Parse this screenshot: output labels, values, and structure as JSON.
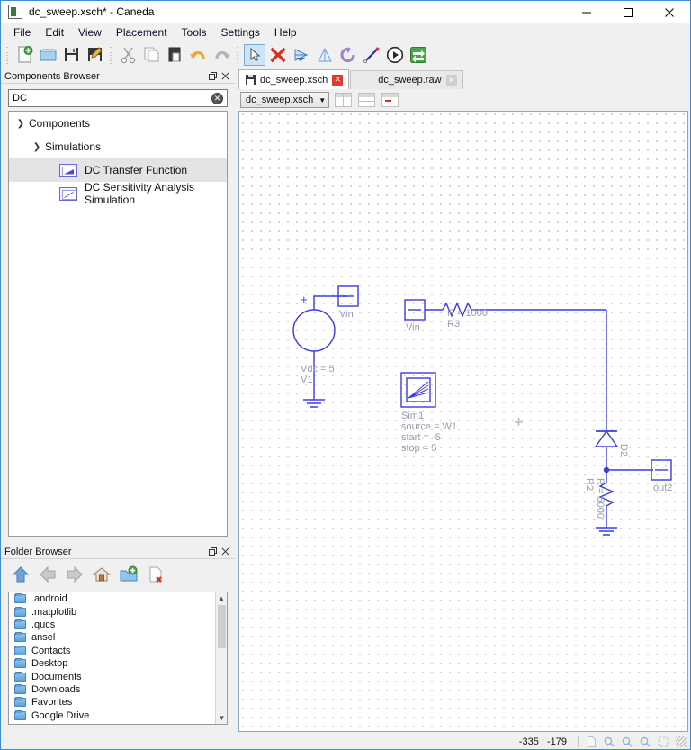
{
  "window": {
    "title": "dc_sweep.xsch* - Caneda",
    "app_icon": "schematic-icon",
    "minimize": "minimize-icon",
    "maximize": "maximize-icon",
    "close": "close-icon"
  },
  "menubar": {
    "items": [
      {
        "label": "File"
      },
      {
        "label": "Edit"
      },
      {
        "label": "View"
      },
      {
        "label": "Placement"
      },
      {
        "label": "Tools"
      },
      {
        "label": "Settings"
      },
      {
        "label": "Help"
      }
    ]
  },
  "toolbar": {
    "groups": [
      {
        "buttons": [
          {
            "name": "new-document-button",
            "icon": "new-document-icon"
          },
          {
            "name": "open-document-button",
            "icon": "open-folder-icon"
          },
          {
            "name": "save-document-button",
            "icon": "floppy-save-icon"
          },
          {
            "name": "save-as-button",
            "icon": "save-as-pencil-icon"
          }
        ]
      },
      {
        "buttons": [
          {
            "name": "cut-button",
            "icon": "scissors-icon"
          },
          {
            "name": "copy-button",
            "icon": "copy-pages-icon"
          },
          {
            "name": "paste-button",
            "icon": "clipboard-paste-icon"
          },
          {
            "name": "undo-button",
            "icon": "undo-arrow-icon"
          },
          {
            "name": "redo-button",
            "icon": "redo-arrow-icon"
          }
        ]
      },
      {
        "buttons": [
          {
            "name": "select-tool-button",
            "icon": "cursor-arrow-icon",
            "selected": true
          },
          {
            "name": "delete-button",
            "icon": "red-cross-icon"
          },
          {
            "name": "mirror-horizontal-button",
            "icon": "mirror-x-icon"
          },
          {
            "name": "mirror-vertical-button",
            "icon": "mirror-y-icon"
          },
          {
            "name": "rotate-button",
            "icon": "rotate-icon"
          },
          {
            "name": "wire-tool-button",
            "icon": "wire-pen-icon"
          },
          {
            "name": "simulate-button",
            "icon": "play-circle-icon"
          },
          {
            "name": "open-simulation-button",
            "icon": "green-exchange-icon"
          }
        ]
      }
    ]
  },
  "components_browser": {
    "title": "Components Browser",
    "float_icon": "undock-icon",
    "close_icon": "close-icon",
    "search": {
      "value": "DC",
      "placeholder": "",
      "clear_icon": "clear-circle-icon"
    },
    "tree": [
      {
        "label": "Components",
        "depth": 0,
        "expander": "chevron-down-icon",
        "icon": null,
        "selected": false
      },
      {
        "label": "Simulations",
        "depth": 1,
        "expander": "chevron-down-icon",
        "icon": null,
        "selected": false
      },
      {
        "label": "DC Transfer Function",
        "depth": 2,
        "expander": null,
        "icon": "dc-transfer-function-icon",
        "selected": true
      },
      {
        "label": "DC Sensitivity Analysis Simulation",
        "depth": 2,
        "expander": null,
        "icon": "dc-sensitivity-icon",
        "selected": false
      }
    ]
  },
  "folder_browser": {
    "title": "Folder Browser",
    "float_icon": "undock-icon",
    "close_icon": "close-icon",
    "toolbar": [
      {
        "name": "go-up-button",
        "icon": "up-arrow-icon"
      },
      {
        "name": "go-back-button",
        "icon": "left-arrow-icon"
      },
      {
        "name": "go-forward-button",
        "icon": "right-arrow-icon"
      },
      {
        "name": "go-home-button",
        "icon": "home-icon"
      },
      {
        "name": "new-folder-button",
        "icon": "new-folder-icon"
      },
      {
        "name": "delete-file-button",
        "icon": "delete-file-icon"
      }
    ],
    "items": [
      {
        "label": ".android",
        "icon": "folder-icon"
      },
      {
        "label": ".matplotlib",
        "icon": "folder-icon"
      },
      {
        "label": ".qucs",
        "icon": "folder-icon"
      },
      {
        "label": "ansel",
        "icon": "folder-icon"
      },
      {
        "label": "Contacts",
        "icon": "folder-icon"
      },
      {
        "label": "Desktop",
        "icon": "folder-icon"
      },
      {
        "label": "Documents",
        "icon": "folder-icon"
      },
      {
        "label": "Downloads",
        "icon": "folder-icon"
      },
      {
        "label": "Favorites",
        "icon": "folder-icon"
      },
      {
        "label": "Google Drive",
        "icon": "folder-icon"
      }
    ],
    "scroll_up_icon": "chevron-up-icon",
    "scroll_down_icon": "chevron-down-icon"
  },
  "editor": {
    "tabs": [
      {
        "label": "dc_sweep.xsch",
        "icon": "floppy-save-icon",
        "close_icon": "close-icon",
        "active": true
      },
      {
        "label": "dc_sweep.raw",
        "icon": null,
        "close_icon": "close-icon",
        "active": false
      }
    ],
    "subtoolbar": {
      "document_combo": {
        "value": "dc_sweep.xsch",
        "arrow": "chevron-down-icon"
      },
      "buttons": [
        {
          "name": "split-vertical-button",
          "icon": "split-vertical-icon"
        },
        {
          "name": "split-horizontal-button",
          "icon": "split-horizontal-icon"
        },
        {
          "name": "close-split-button",
          "icon": "close-split-icon"
        }
      ]
    }
  },
  "schematic": {
    "labels": {
      "vsource_value": "Vdc = 5",
      "vsource_name": "V1",
      "vsource_plus": "+",
      "vsource_minus": "−",
      "port_in_label": "Vin",
      "port_in2_label": "Vin",
      "resistor1_value": "R = 1000",
      "resistor1_name": "R3",
      "resistor2_value": "R = 5000",
      "resistor2_name": "R2",
      "diode_name": "D2",
      "port_out_label": "out2",
      "sim_name": "Sim1",
      "sim_source": "source = W1",
      "sim_start": "start = -5",
      "sim_stop": "stop = 5"
    },
    "colors": {
      "wire": "#3b3be0",
      "symbol": "#4040e0",
      "label": "#9a9ab4",
      "grid": "#c8c8c8"
    }
  },
  "statusbar": {
    "coordinates": "-335 : -179",
    "icons": [
      {
        "name": "fit-page-icon"
      },
      {
        "name": "zoom-in-icon"
      },
      {
        "name": "zoom-out-icon"
      },
      {
        "name": "zoom-reset-icon"
      },
      {
        "name": "zoom-fit-icon"
      }
    ]
  }
}
